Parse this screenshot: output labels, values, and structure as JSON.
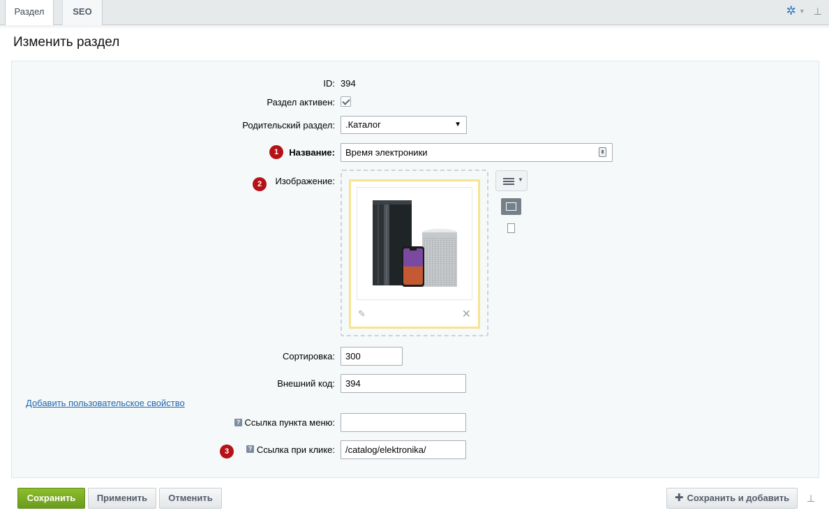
{
  "tabs": [
    {
      "label": "Раздел"
    },
    {
      "label": "SEO"
    }
  ],
  "page_title": "Изменить раздел",
  "form": {
    "id_label": "ID:",
    "id_value": "394",
    "active_label": "Раздел активен:",
    "active_checked": true,
    "parent_label": "Родительский раздел:",
    "parent_value": ".Каталог",
    "name_label": "Название:",
    "name_value": "Время электроники",
    "image_label": "Изображение:",
    "sort_label": "Сортировка:",
    "sort_value": "300",
    "extcode_label": "Внешний код:",
    "extcode_value": "394",
    "add_property_link": "Добавить пользовательское свойство",
    "menu_link_label": "Ссылка пункта меню:",
    "menu_link_value": "",
    "click_link_label": "Ссылка при клике:",
    "click_link_value": "/catalog/elektronika/"
  },
  "badges": [
    "1",
    "2",
    "3"
  ],
  "buttons": {
    "save": "Сохранить",
    "apply": "Применить",
    "cancel": "Отменить",
    "save_add": "Сохранить и добавить"
  },
  "colors": {
    "accent": "#2a78bd",
    "save_button": "#6ea42c",
    "badge": "#b51218",
    "link": "#2067b0"
  }
}
